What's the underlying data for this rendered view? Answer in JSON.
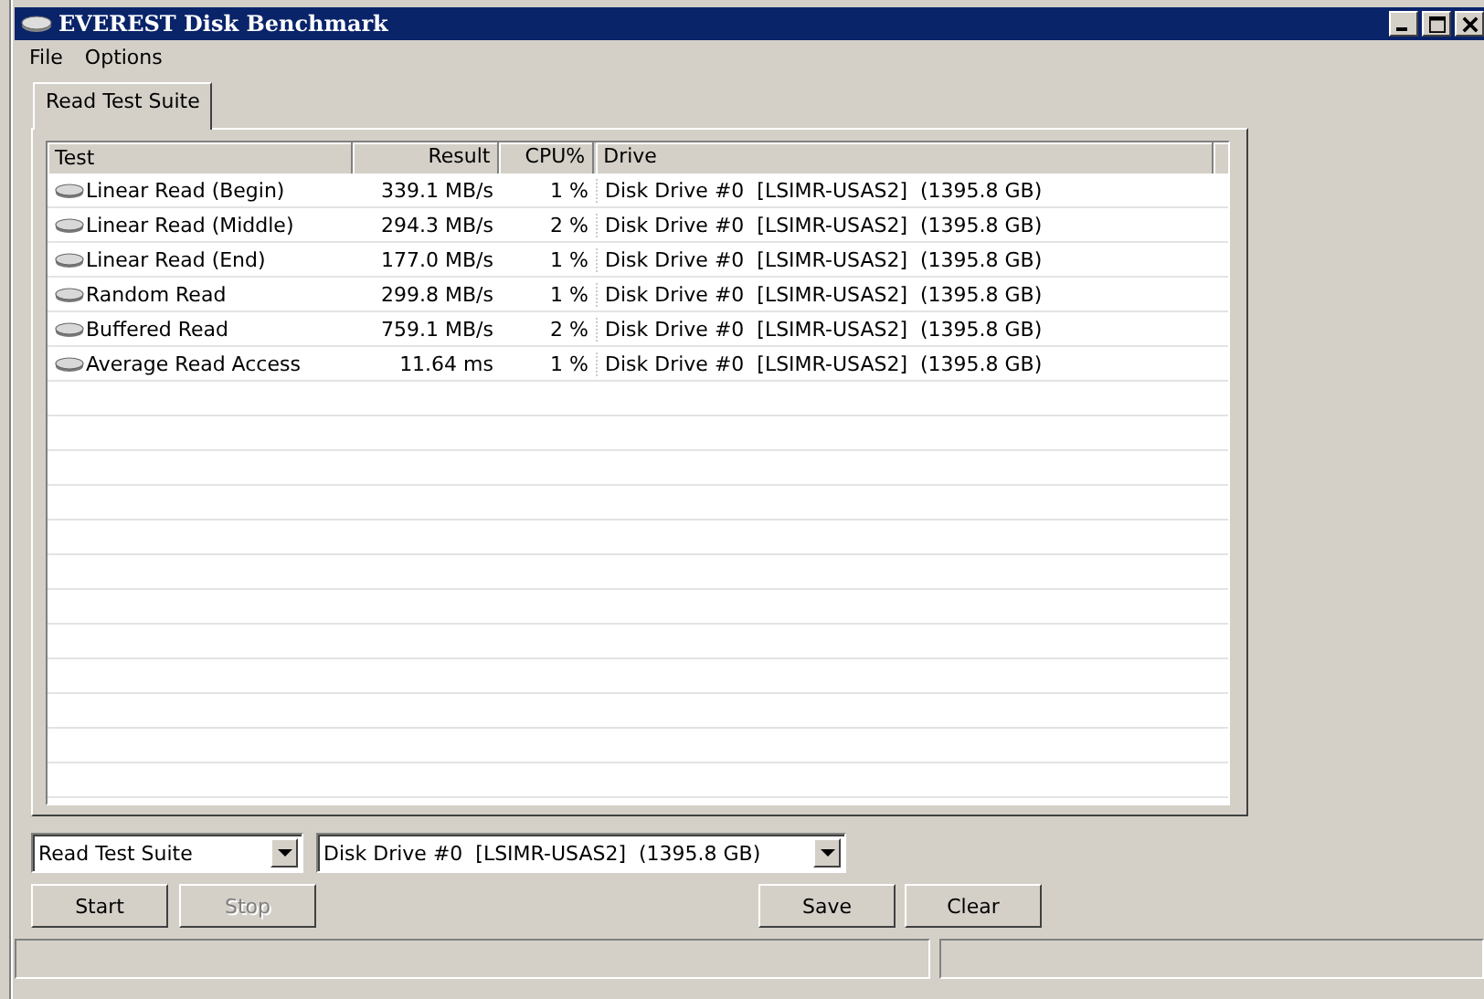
{
  "window": {
    "title": "EVEREST Disk Benchmark"
  },
  "menu": [
    "File",
    "Options"
  ],
  "tabs": [
    {
      "label": "Read Test Suite",
      "selected": true
    }
  ],
  "table": {
    "columns": [
      "Test",
      "Result",
      "CPU%",
      "Drive"
    ],
    "rows": [
      {
        "test": "Linear Read (Begin)",
        "result": "339.1 MB/s",
        "cpu": "1 %",
        "drive": "Disk Drive #0  [LSIMR-USAS2]  (1395.8 GB)"
      },
      {
        "test": "Linear Read (Middle)",
        "result": "294.3 MB/s",
        "cpu": "2 %",
        "drive": "Disk Drive #0  [LSIMR-USAS2]  (1395.8 GB)"
      },
      {
        "test": "Linear Read (End)",
        "result": "177.0 MB/s",
        "cpu": "1 %",
        "drive": "Disk Drive #0  [LSIMR-USAS2]  (1395.8 GB)"
      },
      {
        "test": "Random Read",
        "result": "299.8 MB/s",
        "cpu": "1 %",
        "drive": "Disk Drive #0  [LSIMR-USAS2]  (1395.8 GB)"
      },
      {
        "test": "Buffered Read",
        "result": "759.1 MB/s",
        "cpu": "2 %",
        "drive": "Disk Drive #0  [LSIMR-USAS2]  (1395.8 GB)"
      },
      {
        "test": "Average Read Access",
        "result": "11.64 ms",
        "cpu": "1 %",
        "drive": "Disk Drive #0  [LSIMR-USAS2]  (1395.8 GB)"
      }
    ]
  },
  "suite_select": {
    "value": "Read Test Suite"
  },
  "drive_select": {
    "value": "Disk Drive #0  [LSIMR-USAS2]  (1395.8 GB)"
  },
  "buttons": [
    {
      "label": "Start",
      "disabled": false
    },
    {
      "label": "Stop",
      "disabled": true
    },
    {
      "label": "Save",
      "disabled": false
    },
    {
      "label": "Clear",
      "disabled": false
    }
  ]
}
